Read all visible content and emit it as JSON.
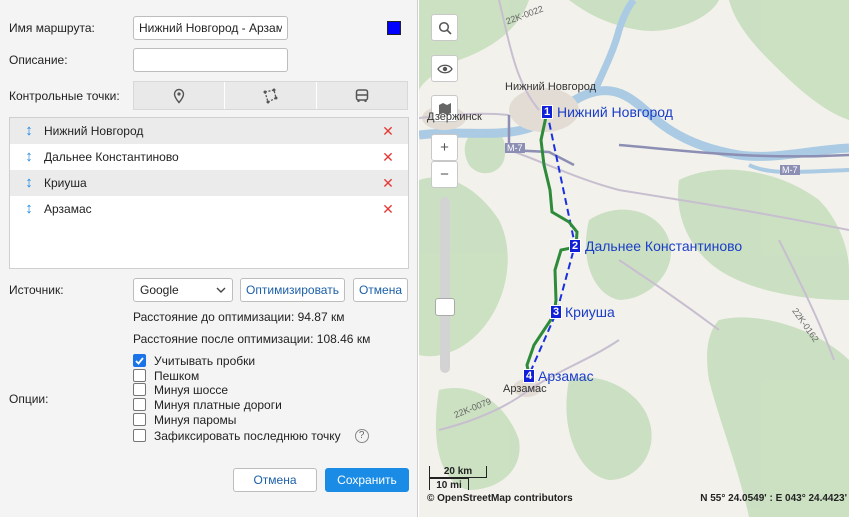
{
  "form": {
    "route_name_label": "Имя маршрута:",
    "route_name_value": "Нижний Новгород - Арзамас",
    "route_color": "#0000ff",
    "description_label": "Описание:",
    "description_value": "",
    "checkpoints_label": "Контрольные точки:",
    "checkpoint_tabs": [
      {
        "icon": "map-pin-icon"
      },
      {
        "icon": "polygon-icon"
      },
      {
        "icon": "bus-icon"
      }
    ],
    "points": [
      {
        "name": "Нижний Новгород"
      },
      {
        "name": "Дальнее Константиново"
      },
      {
        "name": "Криуша"
      },
      {
        "name": "Арзамас"
      }
    ],
    "source_label": "Источник:",
    "source_value": "Google",
    "optimize_label": "Оптимизировать",
    "cancel_small_label": "Отмена",
    "dist_before": "Расстояние до оптимизации: 94.87 км",
    "dist_after": "Расстояние после оптимизации: 108.46 км",
    "options_label": "Опции:",
    "options": [
      {
        "label": "Учитывать пробки",
        "checked": true
      },
      {
        "label": "Пешком",
        "checked": false
      },
      {
        "label": "Минуя шоссе",
        "checked": false
      },
      {
        "label": "Минуя платные дороги",
        "checked": false
      },
      {
        "label": "Минуя паромы",
        "checked": false
      },
      {
        "label": "Зафиксировать последнюю точку",
        "checked": false
      }
    ],
    "help_glyph": "?",
    "cancel_label": "Отмена",
    "save_label": "Сохранить"
  },
  "map": {
    "markers": [
      {
        "num": "1",
        "label": "Нижний Новгород"
      },
      {
        "num": "2",
        "label": "Дальнее Константиново"
      },
      {
        "num": "3",
        "label": "Криуша"
      },
      {
        "num": "4",
        "label": "Арзамас"
      }
    ],
    "places": {
      "nn": "Нижний Новгород",
      "dz": "Дзержинск",
      "arz": "Арзамас"
    },
    "roads": {
      "r1": "22K-0022",
      "r2": "M-7",
      "r3": "M-7",
      "r4": "22K-0079",
      "r5": "22K-0162"
    },
    "scale_km": "20 km",
    "scale_mi": "10 mi",
    "attribution": "© OpenStreetMap contributors",
    "coords": "N 55° 24.0549' : E 043° 24.4423'"
  }
}
